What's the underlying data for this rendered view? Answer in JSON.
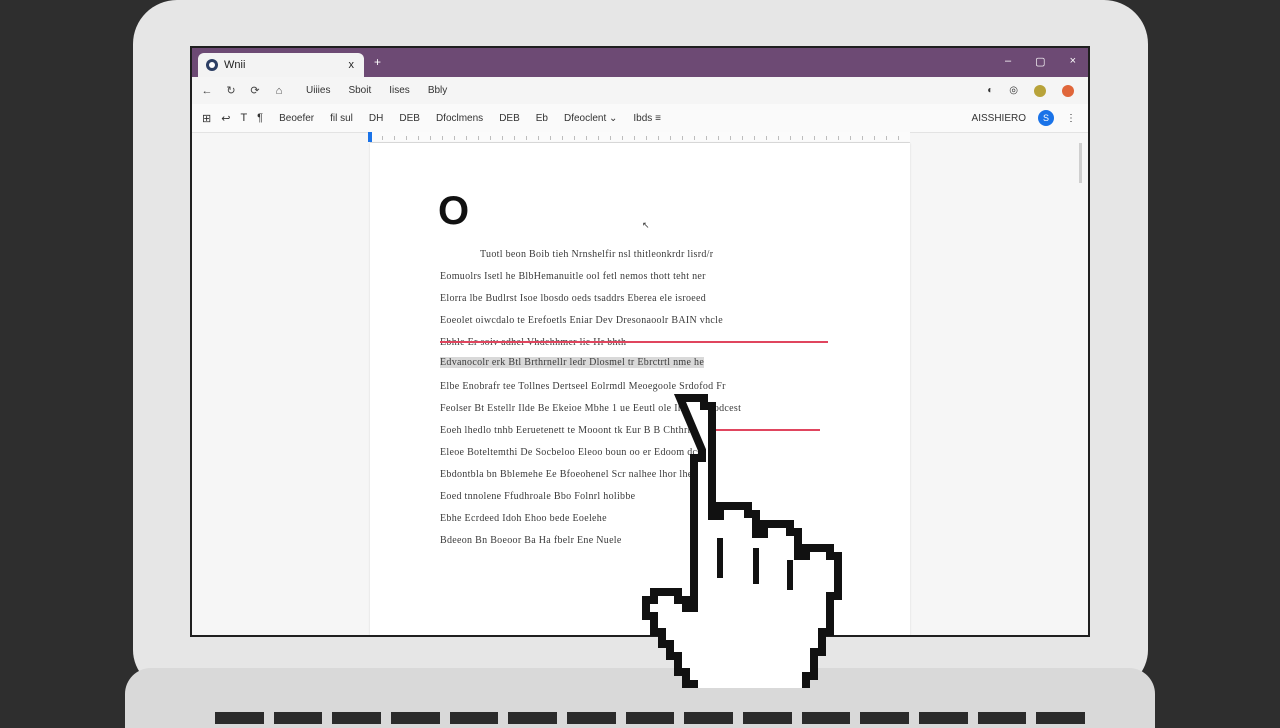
{
  "window": {
    "tab_title": "Wnii",
    "tab_close": "x",
    "new_tab": "+",
    "controls": [
      "–",
      "▢",
      "×"
    ]
  },
  "menubar": {
    "items": [
      "Uiiies",
      "Sboit",
      "Iises",
      "Bbly"
    ],
    "icons": [
      "←",
      "↻",
      "⟳",
      "⌂"
    ],
    "right_icons": [
      "◐",
      "◎"
    ]
  },
  "toolbar": {
    "icons": [
      "⊞",
      "↩",
      "T",
      "¶"
    ],
    "items": [
      "Beoefer",
      "fil sul",
      "DH",
      "DEB",
      "Dfoclmens",
      "DEB",
      "Eb",
      "Dfeoclent ⌄",
      "Ibds ≡"
    ],
    "share_label": "AISSHIERO",
    "share_icon": "S",
    "more": "⋮"
  },
  "document": {
    "heading": "O",
    "lines": [
      "Tuotl beon Boib tieh Nrnshelfir nsl thitleonkrdr lisrd/r",
      "Eomuolrs Isetl he BlbHemanuitle ool fetl nemos thott teht ner",
      "Elorra lbe Budlrst Isoe lbosdo oeds tsaddrs Eberea ele isroeed",
      "Eoeolet oiwcdalo te Erefoetls Eniar Dev Dresonaoolr BAIN vhcle",
      "Ebhle Er soiv adhel Vhdehhmer lie Hr bhth",
      "Edvanocolr erk Btl Brthrnellr ledr Dlosmel tr Ebrctrtl nme he",
      "Elbe Enobrafr tee Tollnes Dertseel Eolrmdl Meoegoole Srdofod Fr",
      "Feolser Bt Estellr Ilde Be Ekeioe Mbhe 1 ue Eeutl ole Ihiolee Bodcest",
      "Eoeh lhedlo tnhb Eeruetenett te Mooont tk Eur B B Chthrhe",
      "Eleoe Boteltemthi De Socbeloo Eleoo boun oo er Edoom dcsrle",
      "Ebdontbla bn Bblemehe Ee Bfoeohenel Scr nalhee lhor lhe lhes",
      "Eoed tnnolene Ffudhroale Bbo Folnrl holibbe",
      "Ebhe Ecrdeed Idoh Ehoo bede Eoelehe",
      "Bdeeon Bn Boeoor Ba Ha fbelr Ene Nuele"
    ]
  },
  "colors": {
    "titlebar": "#6d4a74",
    "accent": "#1a73e8",
    "spell_underline": "#e0455e"
  },
  "cursor_icon": "pointing-hand-cursor"
}
